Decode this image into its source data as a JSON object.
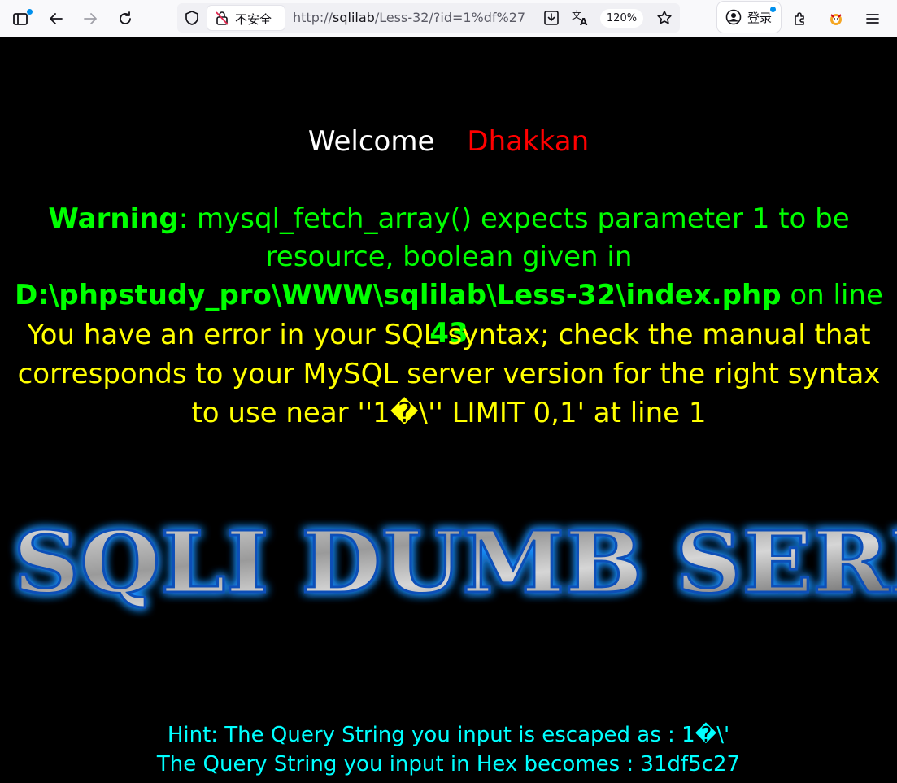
{
  "browser": {
    "insecure_label": "不安全",
    "url_prefix": "http://",
    "url_host": "sqlilab",
    "url_path": "/Less-32/?id=1%df%27",
    "zoom": "120%",
    "login_label": "登录"
  },
  "page": {
    "welcome_label": "Welcome",
    "welcome_name": "Dhakkan",
    "warning_label": "Warning",
    "warning_text": ": mysql_fetch_array() expects parameter 1 to be resource, boolean given in ",
    "warning_path": "D:\\phpstudy_pro\\WWW\\sqlilab\\Less-32\\index.php",
    "warning_online": " on line ",
    "warning_line": "43",
    "sql_error": "You have an error in your SQL syntax; check the manual that corresponds to your MySQL server version for the right syntax to use near ''1�\\'' LIMIT 0,1' at line 1",
    "logo_text": "SQLI DUMB SERIES",
    "hint_escaped": "Hint: The Query String you input is escaped as : 1�\\'",
    "hint_hex": "The Query String you input in Hex becomes : 31df5c27"
  },
  "colors": {
    "background": "#000000",
    "welcome": "#ffffff",
    "name": "#ff0000",
    "warning": "#00ff00",
    "sql_error": "#ffff00",
    "hint": "#00ffff",
    "logo_glow": "#1e90ff"
  }
}
